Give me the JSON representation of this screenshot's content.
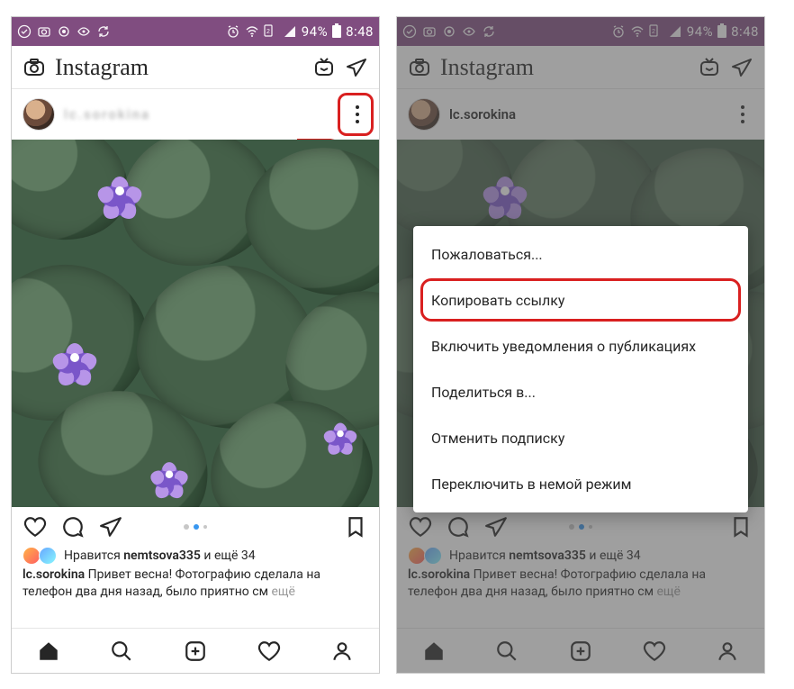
{
  "status": {
    "battery_pct": "94%",
    "time": "8:48"
  },
  "header": {
    "logo_text": "Instagram"
  },
  "post": {
    "username_left": "lc.sorokina",
    "username_right": "lc.sorokina",
    "likes_prefix": "Нравится",
    "liker_name": "nemtsova335",
    "likes_and_more": "и ещё 34",
    "caption_user": "lc.sorokina",
    "caption_text": "Привет весна! Фотографию сделала на телефон два дня назад, было приятно см",
    "more_label": "ещё"
  },
  "menu": {
    "items": [
      "Пожаловаться...",
      "Копировать ссылку",
      "Включить уведомления о публикациях",
      "Поделиться в...",
      "Отменить подписку",
      "Переключить в немой режим"
    ]
  }
}
